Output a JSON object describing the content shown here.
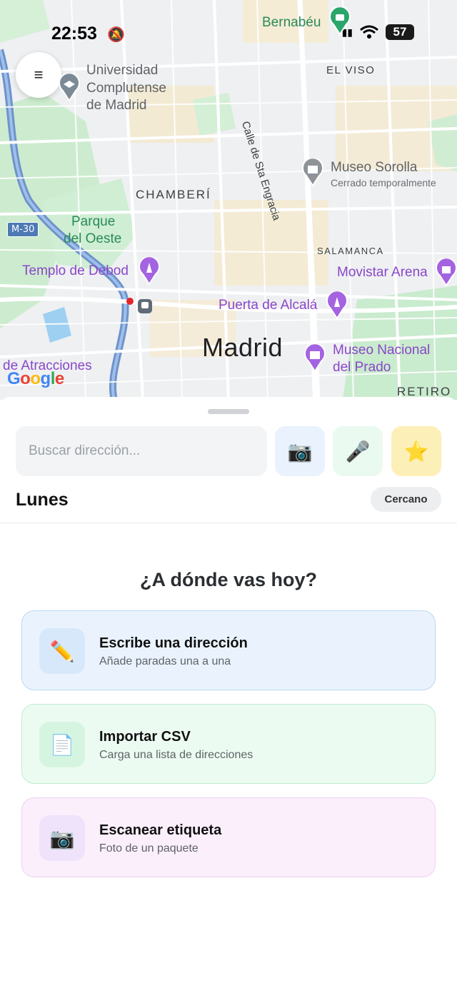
{
  "status_bar": {
    "time": "22:53",
    "battery": "57"
  },
  "map": {
    "labels": {
      "bernabeu": "Bernabéu",
      "universidad_1": "Universidad",
      "universidad_2": "Complutense",
      "universidad_3": "de Madrid",
      "el_viso": "EL VISO",
      "street_sta_engracia": "Calle de Sta Engracia",
      "museo_sorolla": "Museo Sorolla",
      "sorolla_status": "Cerrado temporalmente",
      "chamberi": "CHAMBERÍ",
      "parque_1": "Parque",
      "parque_2": "del Oeste",
      "m30": "M-30",
      "salamanca": "SALAMANCA",
      "templo_debod": "Templo de Debod",
      "movistar_arena": "Movistar Arena",
      "puerta_alcala": "Puerta de Alcalá",
      "madrid": "Madrid",
      "museo_prado_1": "Museo Nacional",
      "museo_prado_2": "del Prado",
      "atracciones": "de Atracciones",
      "retiro": "RETIRO",
      "google_g": "G",
      "google_o1": "o",
      "google_o2": "o",
      "google_g2": "g",
      "google_l": "l",
      "google_e": "e"
    },
    "menu_icon": "≡"
  },
  "sheet": {
    "search_placeholder": "Buscar dirección...",
    "camera_icon": "📷",
    "mic_icon": "🎤",
    "star_icon": "⭐",
    "day_title": "Lunes",
    "nearby_label": "Cercano",
    "prompt": "¿A dónde vas hoy?",
    "cards": [
      {
        "icon": "✏️",
        "title": "Escribe una dirección",
        "subtitle": "Añade paradas una a una"
      },
      {
        "icon": "📄",
        "title": "Importar CSV",
        "subtitle": "Carga una lista de direcciones"
      },
      {
        "icon": "📷",
        "title": "Escanear etiqueta",
        "subtitle": "Foto de un paquete"
      }
    ]
  },
  "colors": {
    "accent_green": "#2a8a58",
    "poi_purple": "#8a47c9",
    "card_blue": "#eaf3fd",
    "card_green": "#ecfbf1",
    "card_pink": "#fbeffc"
  }
}
